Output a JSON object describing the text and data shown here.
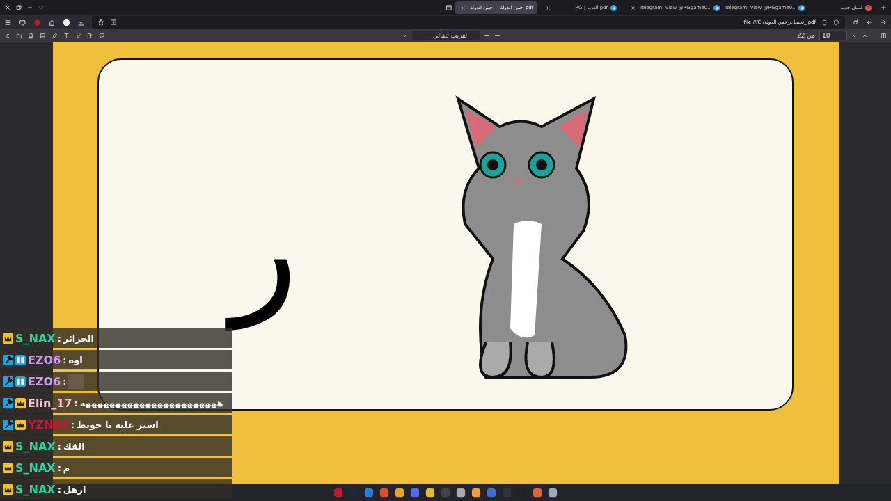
{
  "tabs": [
    {
      "label": "لسان جديد",
      "selected": false,
      "kind": "browser"
    },
    {
      "label": "Telegram: View @RGgame01",
      "selected": false,
      "kind": "telegram"
    },
    {
      "label": "Telegram: View @RGgame01",
      "selected": false,
      "kind": "telegram"
    },
    {
      "label": "RG | العاب pdf",
      "selected": false,
      "kind": "telegram"
    },
    {
      "label": "خمن الدولة - _خمن الدولة_pdf",
      "selected": true,
      "kind": "pdf"
    }
  ],
  "address_bar": {
    "url": "file:///C:/تحميل/_خمن الدولة_.pdf"
  },
  "pdf_toolbar": {
    "zoom": "تقريب تلقائي",
    "page_input": "10",
    "page_count": "من 22"
  },
  "page": {
    "letter": "ر"
  },
  "chat": {
    "messages": [
      {
        "name": "S_NAX",
        "separator": ":",
        "color": "#2fd5a0",
        "badges": [
          {
            "kind": "crown"
          }
        ],
        "kind": "text",
        "text": "الجزائر"
      },
      {
        "name": "EZO6",
        "separator": ":",
        "color": "#c79bf2",
        "badges": [
          {
            "kind": "mod"
          },
          {
            "kind": "rg"
          }
        ],
        "kind": "text",
        "text": "اوه"
      },
      {
        "name": "EZO6",
        "separator": ":",
        "color": "#c79bf2",
        "badges": [
          {
            "kind": "mod"
          },
          {
            "kind": "rg"
          }
        ],
        "kind": "emote"
      },
      {
        "name": "Elin_17",
        "separator": ":",
        "color": "#f4c2d7",
        "badges": [
          {
            "kind": "mod"
          },
          {
            "kind": "crown"
          }
        ],
        "kind": "text",
        "text": "هههههههههههههههههههههههه"
      },
      {
        "name": "YZN06",
        "separator": ":",
        "color": "#d0103a",
        "badges": [
          {
            "kind": "mod"
          },
          {
            "kind": "crown"
          }
        ],
        "kind": "text",
        "text": "استر عليه يا جويط"
      },
      {
        "name": "S_NAX",
        "separator": ":",
        "color": "#2fd5a0",
        "badges": [
          {
            "kind": "crown"
          }
        ],
        "kind": "text",
        "text": "القك"
      },
      {
        "name": "S_NAX",
        "separator": ":",
        "color": "#2fd5a0",
        "badges": [
          {
            "kind": "crown"
          }
        ],
        "kind": "text",
        "text": "م"
      },
      {
        "name": "S_NAX",
        "separator": ":",
        "color": "#2fd5a0",
        "badges": [
          {
            "kind": "crown"
          }
        ],
        "kind": "text",
        "text": "ازهل"
      }
    ]
  }
}
